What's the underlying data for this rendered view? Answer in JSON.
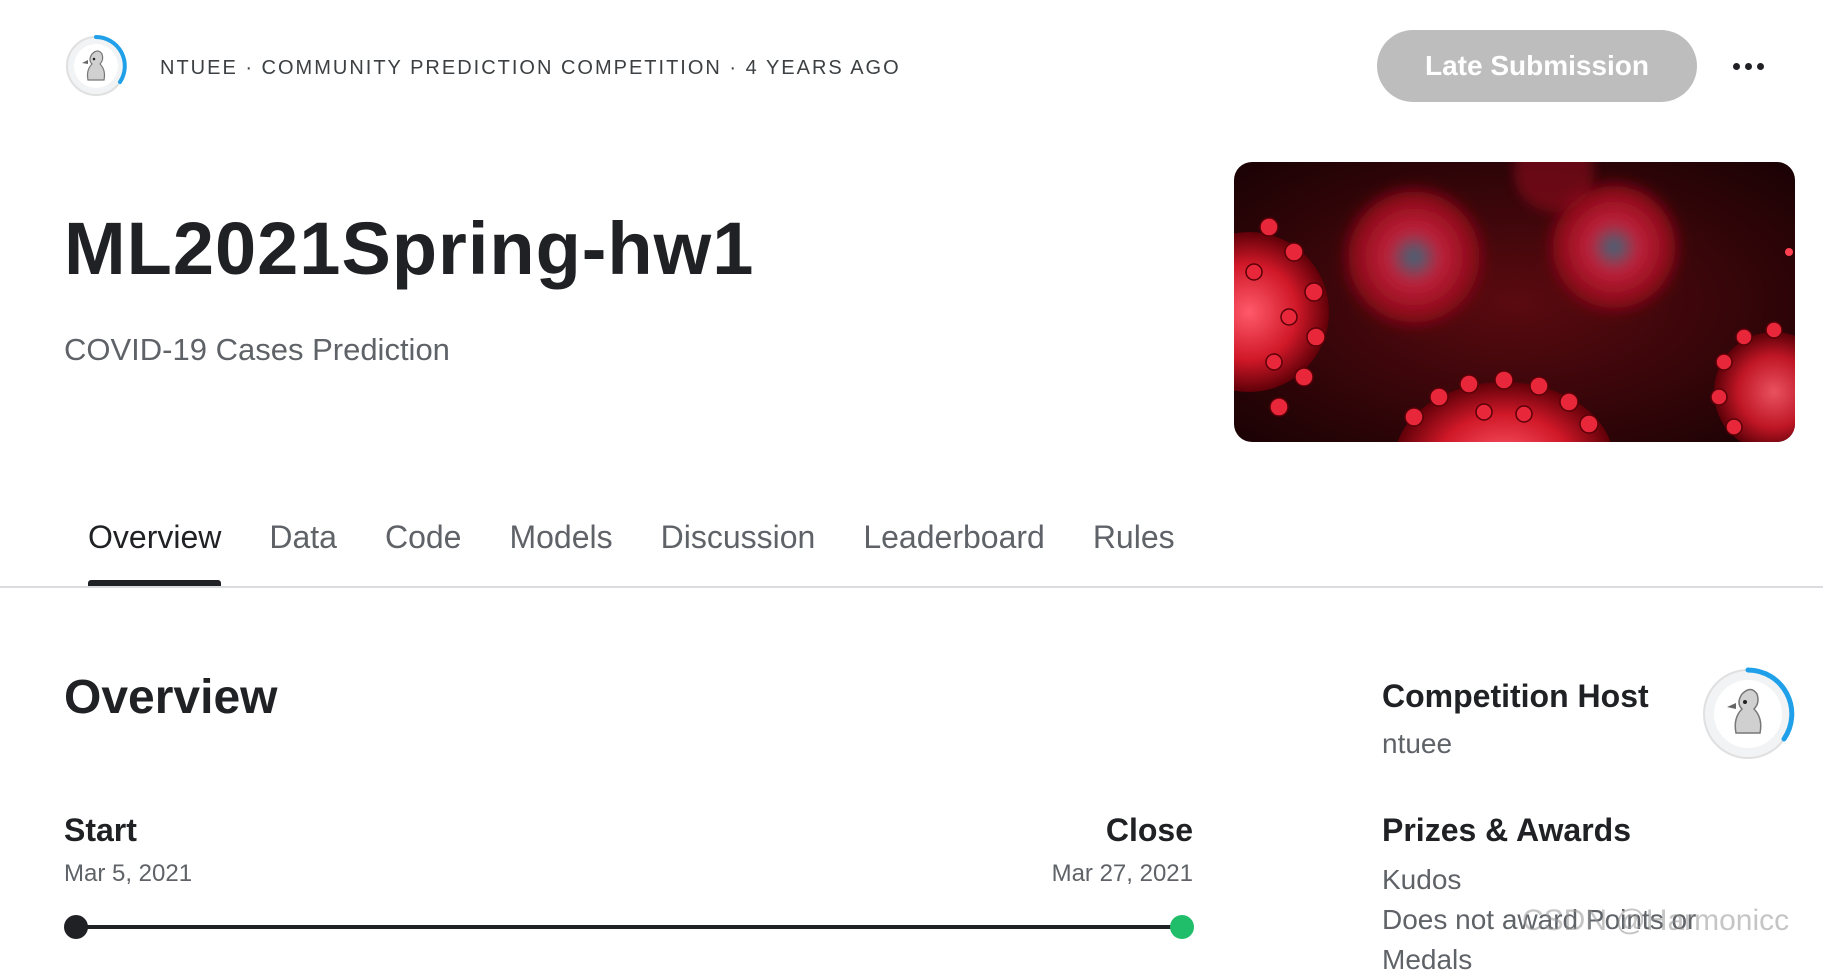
{
  "header": {
    "breadcrumb": "NTUEE · COMMUNITY PREDICTION COMPETITION · 4 YEARS AGO",
    "late_submission_label": "Late Submission",
    "more_icon": "more-horizontal-icon"
  },
  "competition": {
    "title": "ML2021Spring-hw1",
    "subtitle": "COVID-19 Cases Prediction"
  },
  "tabs": [
    {
      "label": "Overview",
      "active": true
    },
    {
      "label": "Data"
    },
    {
      "label": "Code"
    },
    {
      "label": "Models"
    },
    {
      "label": "Discussion"
    },
    {
      "label": "Leaderboard"
    },
    {
      "label": "Rules"
    }
  ],
  "overview": {
    "heading": "Overview",
    "start_label": "Start",
    "start_date": "Mar 5, 2021",
    "close_label": "Close",
    "close_date": "Mar 27, 2021",
    "progress": 1.0
  },
  "sidebar": {
    "host_heading": "Competition Host",
    "host_name": "ntuee",
    "prizes_heading": "Prizes & Awards",
    "prize_lines": [
      "Kudos",
      "Does not award Points or",
      "Medals"
    ]
  },
  "watermark": "CSDN @Harmonicc",
  "colors": {
    "accent_ring": "#20a0e8",
    "button_disabled": "#bdbdbd",
    "timeline_end": "#20be6a",
    "banner_red": "#b01020"
  }
}
